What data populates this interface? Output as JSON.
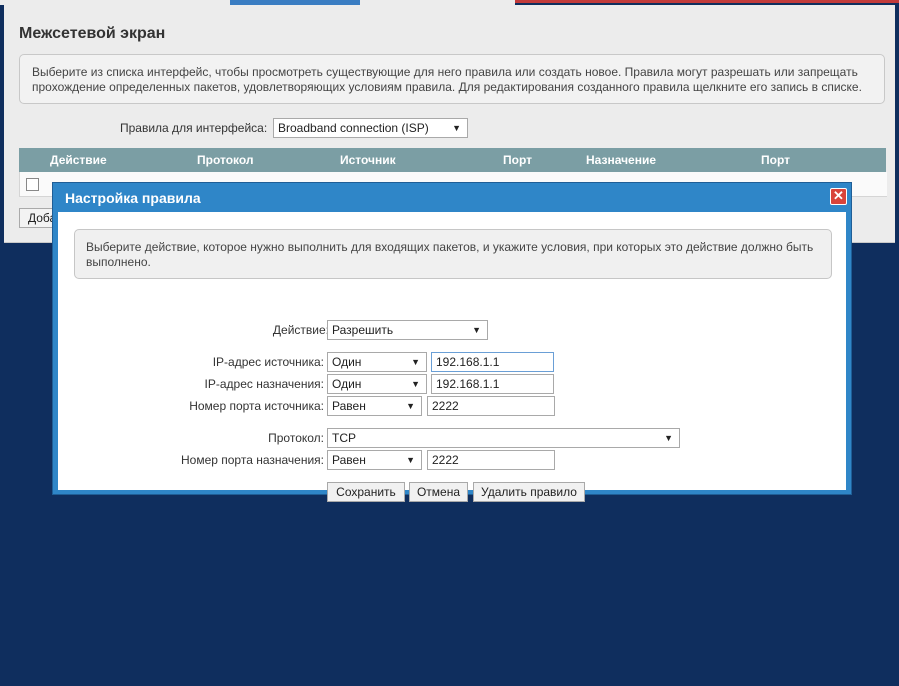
{
  "colors": {
    "background": "#0f2e5e",
    "dialog_frame": "#2f86c8",
    "table_header": "#7b9ea4",
    "close_button": "#d9443b"
  },
  "page": {
    "title": "Межсетевой экран",
    "info": "Выберите из списка интерфейс, чтобы просмотреть существующие для него правила или создать новое. Правила могут разрешать или запрещать прохождение определенных пакетов, удовлетворяющих условиям правила. Для редактирования созданного правила щелкните его запись в списке.",
    "interface_label": "Правила для интерфейса:",
    "interface_value": "Broadband connection (ISP)",
    "table_headers": [
      "Действие",
      "Протокол",
      "Источник",
      "Порт",
      "Назначение",
      "Порт"
    ],
    "add_button": "Доба"
  },
  "dialog": {
    "title": "Настройка правила",
    "close_icon": "close-icon",
    "info": "Выберите действие, которое нужно выполнить для входящих пакетов, и укажите условия, при которых это действие должно быть выполнено.",
    "action": {
      "label": "Действие:",
      "value": "Разрешить"
    },
    "src_ip": {
      "label": "IP-адрес источника:",
      "mode": "Один",
      "value": "192.168.1.1"
    },
    "dst_ip": {
      "label": "IP-адрес назначения:",
      "mode": "Один",
      "value": "192.168.1.1"
    },
    "src_port": {
      "label": "Номер порта источника:",
      "mode": "Равен",
      "value": "2222"
    },
    "protocol": {
      "label": "Протокол:",
      "value": "TCP"
    },
    "dst_port": {
      "label": "Номер порта назначения:",
      "mode": "Равен",
      "value": "2222"
    },
    "buttons": {
      "save": "Сохранить",
      "cancel": "Отмена",
      "delete": "Удалить правило"
    }
  }
}
